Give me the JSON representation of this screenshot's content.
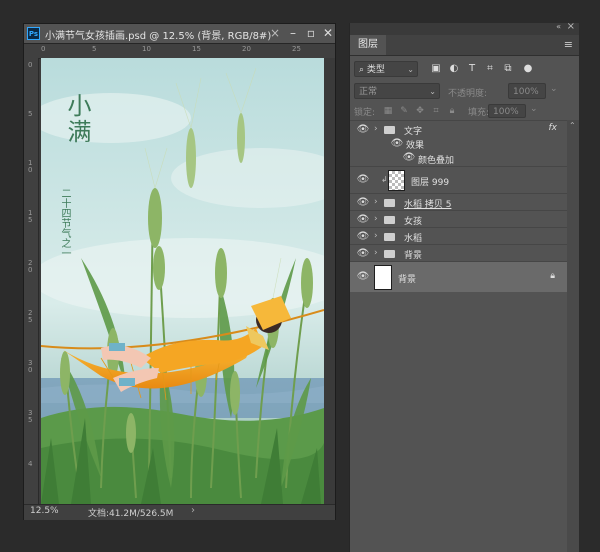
{
  "document": {
    "title": "小满节气女孩插画.psd @ 12.5% (背景, RGB/8#)",
    "app_badge": "Ps",
    "zoom": "12.5%",
    "file_info": "文档:41.2M/526.5M"
  },
  "rulers": {
    "left_labels": [
      "0",
      "5",
      "1\n0",
      "1\n5",
      "2\n0",
      "2\n5",
      "3\n0",
      "3\n5",
      "4"
    ]
  },
  "illustration": {
    "title": "小满",
    "subtitle": "二十四节气之一"
  },
  "layers_panel": {
    "tab": "图层",
    "filter_kind": "类型",
    "blend_mode": "正常",
    "opacity_label": "不透明度:",
    "opacity_value": "100%",
    "lock_label": "锁定:",
    "fill_label": "填充:",
    "fill_value": "100%",
    "layers": [
      {
        "name": "文字",
        "type": "group",
        "fx": "fx"
      },
      {
        "name": "效果",
        "type": "effects"
      },
      {
        "name": "颜色叠加",
        "type": "effect-item"
      },
      {
        "name": "图层 999",
        "type": "layer"
      },
      {
        "name": "水稻 拷贝 5",
        "type": "group"
      },
      {
        "name": "女孩",
        "type": "group"
      },
      {
        "name": "水稻",
        "type": "group"
      },
      {
        "name": "背景",
        "type": "group"
      },
      {
        "name": "背景",
        "type": "background"
      }
    ]
  },
  "colors": {
    "ui_dark": "#2b2b2b",
    "panel": "#535353",
    "accent_title": "#3e7b5a"
  }
}
